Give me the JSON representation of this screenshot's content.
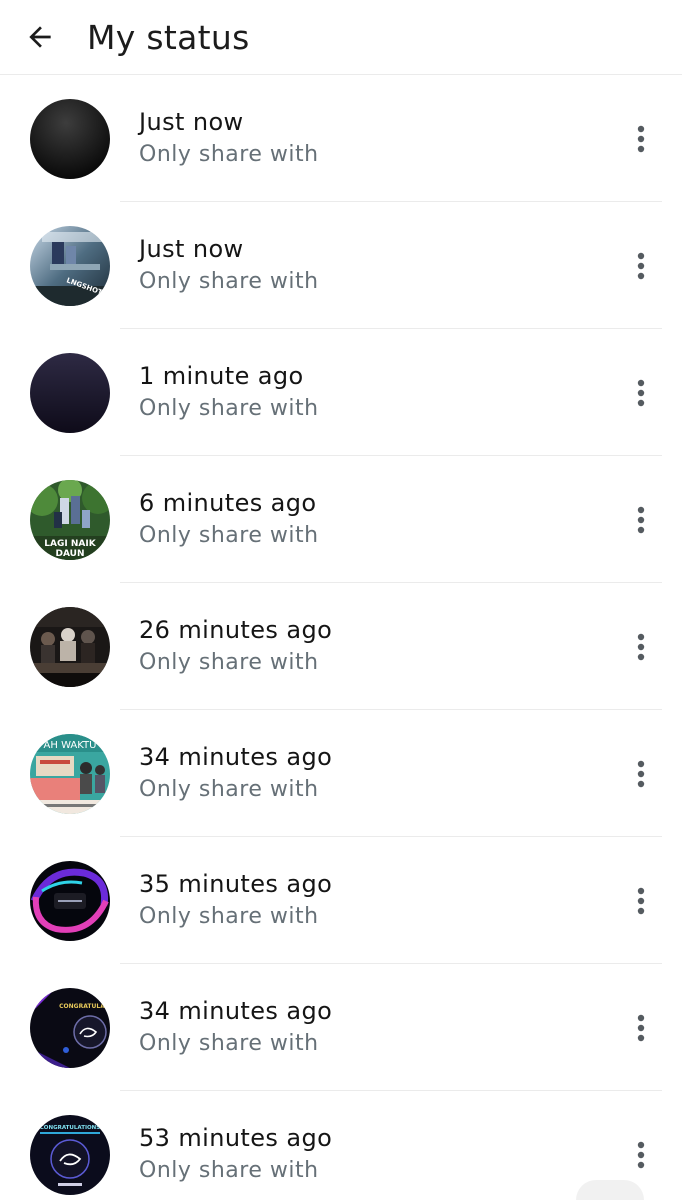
{
  "header": {
    "title": "My status",
    "back_icon": "arrow-left-icon"
  },
  "statuses": [
    {
      "time": "Just now",
      "privacy": "Only share with",
      "thumbnail": "black-gradient-circle"
    },
    {
      "time": "Just now",
      "privacy": "Only share with",
      "thumbnail": "stage-photo",
      "thumb_caption": "LNGSHOT"
    },
    {
      "time": "1 minute ago",
      "privacy": "Only share with",
      "thumbnail": "dark-navy-gradient-circle"
    },
    {
      "time": "6 minutes ago",
      "privacy": "Only share with",
      "thumbnail": "jungle-group-photo",
      "thumb_caption_1": "LAGI NAIK",
      "thumb_caption_2": "DAUN"
    },
    {
      "time": "26 minutes ago",
      "privacy": "Only share with",
      "thumbnail": "band-group-photo"
    },
    {
      "time": "34 minutes ago",
      "privacy": "Only share with",
      "thumbnail": "teal-poster",
      "thumb_caption_1": "AH WAKTU"
    },
    {
      "time": "35 minutes ago",
      "privacy": "Only share with",
      "thumbnail": "neon-swirl-art"
    },
    {
      "time": "34 minutes ago",
      "privacy": "Only share with",
      "thumbnail": "congratulations-poster",
      "thumb_caption_1": "CONGRATULA"
    },
    {
      "time": "53 minutes ago",
      "privacy": "Only share with",
      "thumbnail": "congratulations-badge",
      "thumb_caption_1": "CONGRATULATIONS"
    }
  ],
  "more_icon": "more-vertical-icon",
  "colors": {
    "primary_text": "#151515",
    "secondary_text": "#667077",
    "divider": "#ebebeb",
    "icon": "#555b60"
  }
}
